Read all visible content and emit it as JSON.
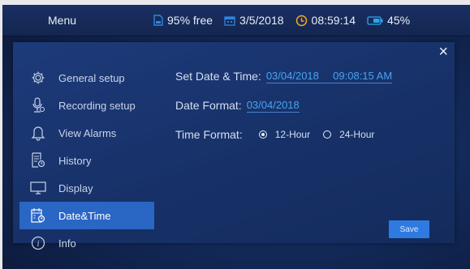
{
  "topbar": {
    "menu_label": "Menu",
    "storage": "95% free",
    "date": "3/5/2018",
    "time": "08:59:14",
    "battery": "45%"
  },
  "sidebar": {
    "items": [
      {
        "label": "General setup",
        "icon": "gear-icon"
      },
      {
        "label": "Recording setup",
        "icon": "microphone-icon"
      },
      {
        "label": "View Alarms",
        "icon": "bell-icon"
      },
      {
        "label": "History",
        "icon": "history-icon"
      },
      {
        "label": "Display",
        "icon": "monitor-icon"
      },
      {
        "label": "Date&Time",
        "icon": "calendar-clock-icon",
        "active": true
      },
      {
        "label": "Info",
        "icon": "info-icon"
      }
    ]
  },
  "content": {
    "set_label": "Set Date & Time:",
    "set_date": "03/04/2018",
    "set_time": "09:08:15 AM",
    "date_format_label": "Date Format:",
    "date_format_value": "03/04/2018",
    "time_format_label": "Time Format:",
    "option_12": "12-Hour",
    "option_24": "24-Hour",
    "selected": "12-Hour"
  },
  "buttons": {
    "save": "Save",
    "close": "×"
  },
  "colors": {
    "accent": "#2a66c4",
    "value_text": "#4aa3f0",
    "save_button": "#2f7ae0",
    "clock_icon": "#f5a623",
    "battery_icon": "#29a8e8",
    "storage_icon": "#2e86de",
    "calendar_icon": "#2e86de"
  }
}
